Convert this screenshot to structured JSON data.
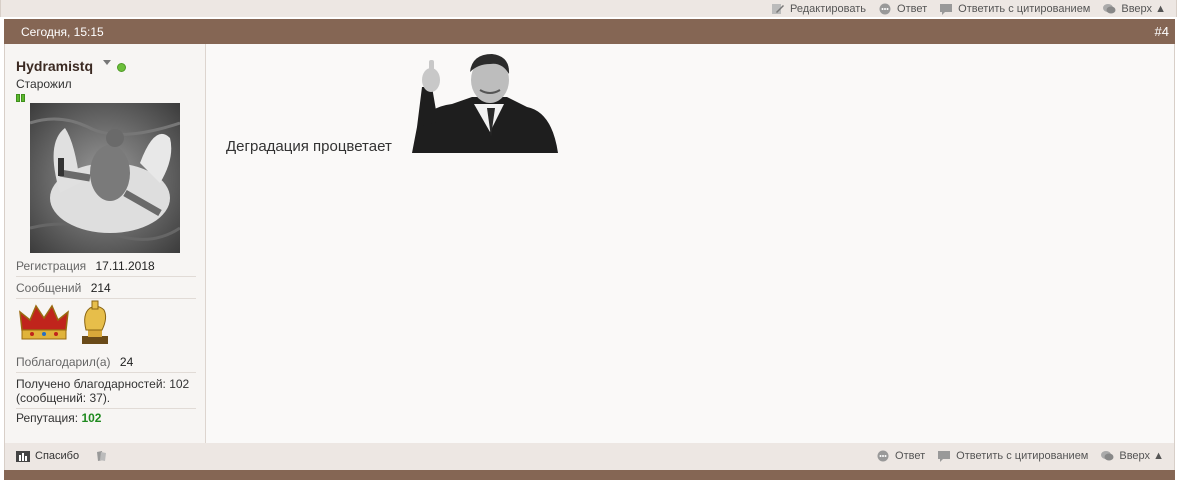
{
  "top_actions": {
    "edit": "Редактировать",
    "reply": "Ответ",
    "quote": "Ответить с цитированием",
    "top": "Вверх ▲"
  },
  "post": {
    "date": "Сегодня, 15:15",
    "number": "#4",
    "text": "Деградация процветает"
  },
  "user": {
    "name": "Hydramistq",
    "rank": "Старожил",
    "reg_label": "Регистрация",
    "reg_value": "17.11.2018",
    "posts_label": "Сообщений",
    "posts_value": "214",
    "thanked_label": "Поблагодарил(а)",
    "thanked_value": "24",
    "received_thanks": "Получено благодарностей: 102 (сообщений: 37).",
    "rep_label": "Репутация:",
    "rep_value": "102"
  },
  "footer": {
    "thanks": "Спасибо",
    "reply": "Ответ",
    "quote": "Ответить с цитированием",
    "top": "Вверх ▲"
  },
  "colors": {
    "header": "#856654",
    "bar": "#ede7e3",
    "online": "#6cbf3a",
    "reputation": "#1f8a1f"
  }
}
